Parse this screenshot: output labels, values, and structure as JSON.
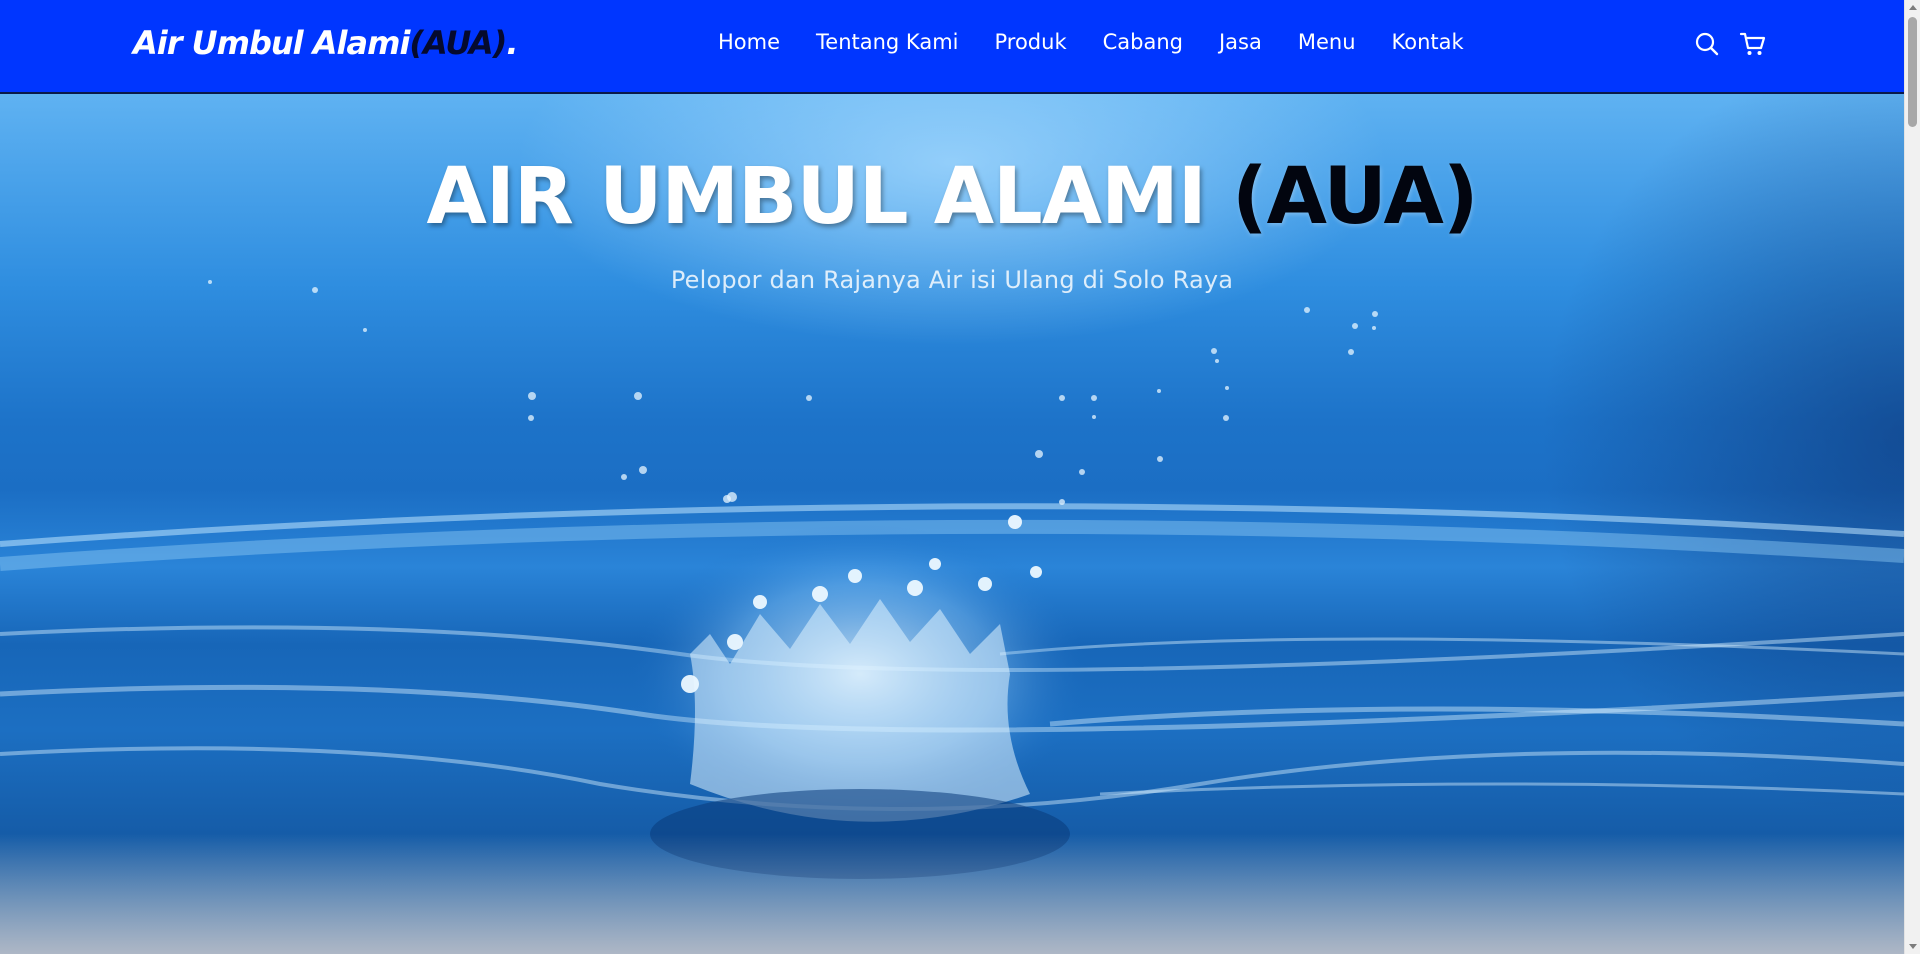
{
  "navbar": {
    "logo_main": "Air Umbul Alami",
    "logo_accent": "(AUA)",
    "logo_dot": ".",
    "links": [
      "Home",
      "Tentang Kami",
      "Produk",
      "Cabang",
      "Jasa",
      "Menu",
      "Kontak"
    ],
    "icons": [
      "search-icon",
      "shopping-cart-icon"
    ]
  },
  "hero": {
    "title_main": "AIR UMBUL ALAMI",
    "title_accent": "(AUA)",
    "subtitle": "Pelopor dan Rajanya Air isi Ulang di Solo Raya"
  },
  "colors": {
    "navbar_bg": "#0036ff",
    "accent_dark": "#050a2e",
    "hero_water": "#1b6ec4"
  }
}
